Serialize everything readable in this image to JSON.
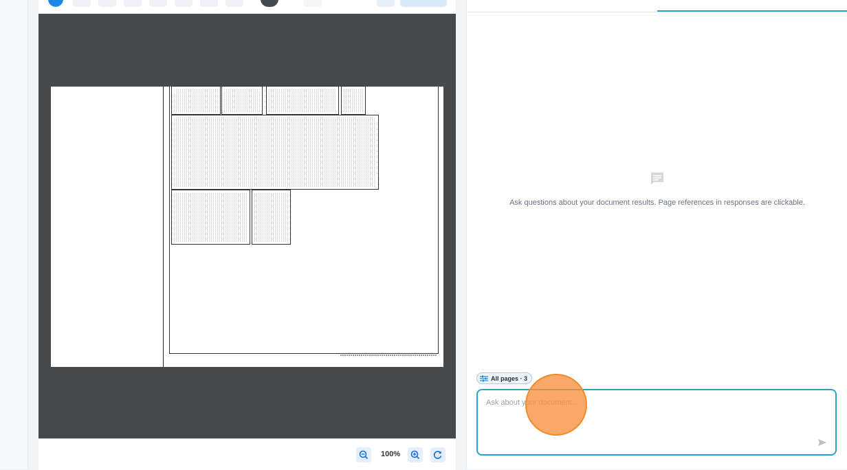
{
  "viewer": {
    "zoom_label": "100%",
    "zoom_out_icon": "zoom-out-icon",
    "zoom_in_icon": "zoom-in-icon",
    "reset_icon": "refresh-icon"
  },
  "chat": {
    "empty_icon": "chat-bubble-icon",
    "empty_message": "Ask questions about your document results. Page references in responses are clickable.",
    "scope_label": "All pages · 3",
    "scope_icon": "tune-icon",
    "input_placeholder": "Ask about your document...",
    "send_icon": "send-icon"
  },
  "colors": {
    "accent": "#26a5c8",
    "viewer_bg": "#474a4d",
    "cursor_highlight": "#f6913c"
  }
}
